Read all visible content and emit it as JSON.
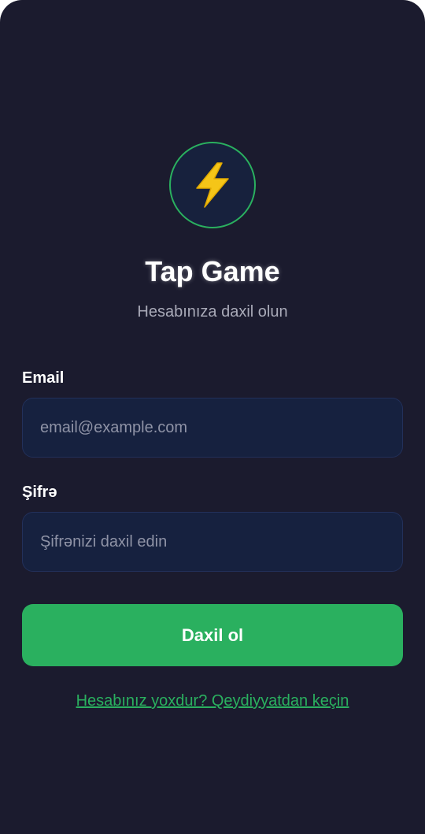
{
  "app": {
    "title": "Tap Game",
    "subtitle": "Hesabınıza daxil olun",
    "logo_icon": "lightning-bolt-icon"
  },
  "form": {
    "email": {
      "label": "Email",
      "value": "",
      "placeholder": "email@example.com"
    },
    "password": {
      "label": "Şifrə",
      "value": "",
      "placeholder": "Şifrənizi daxil edin"
    },
    "submit_label": "Daxil ol"
  },
  "footer": {
    "register_link": "Hesabınız yoxdur? Qeydiyyatdan keçin"
  },
  "colors": {
    "background": "#1b1b2e",
    "accent": "#2ab05f",
    "input_background": "#16213f",
    "bolt": "#f5c518"
  }
}
